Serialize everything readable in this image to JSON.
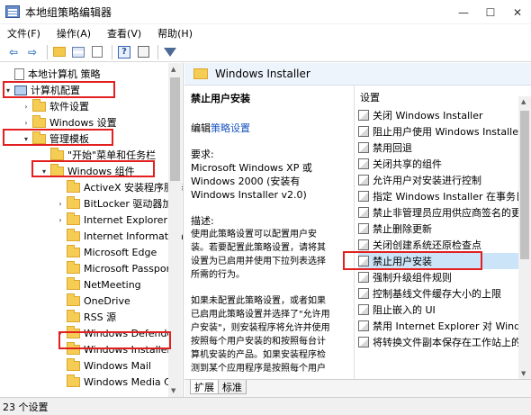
{
  "window": {
    "title": "本地组策略编辑器",
    "minimize_glyph": "—",
    "maximize_glyph": "☐",
    "close_glyph": "✕"
  },
  "menu": [
    "文件(F)",
    "操作(A)",
    "查看(V)",
    "帮助(H)"
  ],
  "toolbar_icons": [
    "back-arrow-icon",
    "forward-arrow-icon",
    "folder-up-icon",
    "show-hide-tree-icon",
    "export-list-icon",
    "help-icon",
    "properties-icon",
    "filter-icon"
  ],
  "tree": {
    "items": [
      {
        "label": "本地计算机 策略",
        "icon": "document-icon",
        "expander": ""
      },
      {
        "label": "计算机配置",
        "icon": "computer-icon",
        "expander": "▾"
      },
      {
        "label": "软件设置",
        "icon": "folder-icon",
        "expander": "›"
      },
      {
        "label": "Windows 设置",
        "icon": "folder-icon",
        "expander": "›"
      },
      {
        "label": "管理模板",
        "icon": "folder-icon",
        "expander": "▾"
      },
      {
        "label": "\"开始\"菜单和任务栏",
        "icon": "folder-icon",
        "expander": ""
      },
      {
        "label": "Windows 组件",
        "icon": "folder-icon",
        "expander": "▾"
      },
      {
        "label": "ActiveX 安装程序服务",
        "icon": "folder-icon",
        "expander": ""
      },
      {
        "label": "BitLocker 驱动器加密",
        "icon": "folder-icon",
        "expander": "›"
      },
      {
        "label": "Internet Explorer",
        "icon": "folder-icon",
        "expander": "›"
      },
      {
        "label": "Internet Information",
        "icon": "folder-icon",
        "expander": ""
      },
      {
        "label": "Microsoft Edge",
        "icon": "folder-icon",
        "expander": ""
      },
      {
        "label": "Microsoft Passport",
        "icon": "folder-icon",
        "expander": ""
      },
      {
        "label": "NetMeeting",
        "icon": "folder-icon",
        "expander": ""
      },
      {
        "label": "OneDrive",
        "icon": "folder-icon",
        "expander": ""
      },
      {
        "label": "RSS 源",
        "icon": "folder-icon",
        "expander": ""
      },
      {
        "label": "Windows Defender",
        "icon": "folder-icon",
        "expander": "›"
      },
      {
        "label": "Windows Installer",
        "icon": "folder-icon",
        "expander": ""
      },
      {
        "label": "Windows Mail",
        "icon": "folder-icon",
        "expander": ""
      },
      {
        "label": "Windows Media Ce",
        "icon": "folder-icon",
        "expander": ""
      }
    ]
  },
  "header": {
    "title": "Windows Installer"
  },
  "description": {
    "title": "禁止用户安装",
    "edit_prefix": "编辑",
    "edit_link": "策略设置",
    "requirements_label": "要求:",
    "requirements_lines": [
      "Microsoft Windows XP 或",
      "Windows 2000 (安装有",
      "Windows Installer v2.0)"
    ],
    "description_label": "描述:",
    "description_lines": [
      "使用此策略设置可以配置用户安",
      "装。若要配置此策略设置，请将其",
      "设置为已启用并使用下拉列表选择",
      "所需的行为。"
    ],
    "extra_lines": [
      "如果未配置此策略设置，或者如果",
      "已启用此策略设置并选择了\"允许用",
      "户安装\"，则安装程序将允许并使用",
      "按照每个用户安装的和按照每台计",
      "算机安装的产品。如果安装程序检",
      "测到某个应用程序是按照每个用户"
    ]
  },
  "settings": {
    "header": "设置",
    "items": [
      "关闭 Windows Installer",
      "阻止用户使用 Windows Installer",
      "禁用回退",
      "关闭共享的组件",
      "允许用户对安装进行控制",
      "指定 Windows Installer 在事务日志",
      "禁止非管理员应用供应商签名的更新",
      "禁止删除更新",
      "关闭创建系统还原检查点",
      "禁止用户安装",
      "强制升级组件规则",
      "控制基线文件缓存大小的上限",
      "阻止嵌入的 UI",
      "禁用 Internet Explorer 对 Windo",
      "将转换文件副本保存在工作站上的"
    ],
    "selected_index": 9
  },
  "tabs": [
    "扩展",
    "标准"
  ],
  "status": {
    "text": "23 个设置"
  },
  "colors": {
    "highlight_box": "#e32020",
    "selection": "#cce4f7",
    "link": "#1a55c0"
  }
}
